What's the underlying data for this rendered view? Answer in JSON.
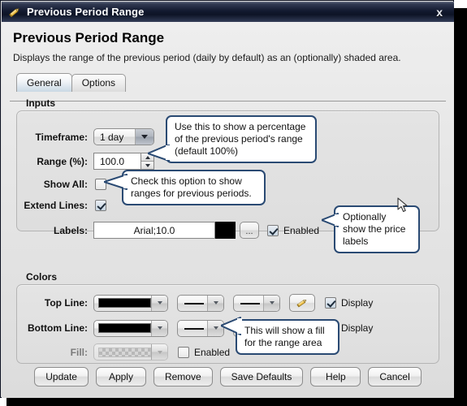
{
  "window": {
    "title": "Previous Period Range",
    "title_icon": "pencil-icon",
    "close_label": "x"
  },
  "header": {
    "title": "Previous Period Range",
    "description": "Displays the range of the previous period (daily by default) as an (optionally) shaded area."
  },
  "tabs": [
    {
      "label": "General",
      "active": true
    },
    {
      "label": "Options",
      "active": false
    }
  ],
  "inputs": {
    "group_label": "Inputs",
    "timeframe": {
      "label": "Timeframe:",
      "value": "1 day"
    },
    "range": {
      "label": "Range (%):",
      "value": "100.0"
    },
    "show_all": {
      "label": "Show All:",
      "checked": false
    },
    "extend_lines": {
      "label": "Extend Lines:",
      "checked": true
    },
    "labels": {
      "label": "Labels:",
      "value": "Arial;10.0",
      "color": "#000000",
      "browse_label": "...",
      "enabled_label": "Enabled",
      "enabled": true
    }
  },
  "colors": {
    "group_label": "Colors",
    "top_line": {
      "label": "Top Line:",
      "color": "#000000",
      "style": "solid-line",
      "weight": "solid-line",
      "edit_icon": "pencil-icon",
      "display_label": "Display",
      "display": true
    },
    "bottom_line": {
      "label": "Bottom Line:",
      "color": "#000000",
      "style": "solid-line",
      "weight": "solid-line",
      "edit_icon": "pencil-icon",
      "display_label": "Display",
      "display": true
    },
    "fill": {
      "label": "Fill:",
      "color": "transparent-checker",
      "enabled_label": "Enabled",
      "enabled": false,
      "disabled": true
    }
  },
  "buttons": [
    {
      "label": "Update"
    },
    {
      "label": "Apply"
    },
    {
      "label": "Remove"
    },
    {
      "label": "Save Defaults"
    },
    {
      "label": "Help"
    },
    {
      "label": "Cancel"
    }
  ],
  "callouts": [
    {
      "text": "Use this to show a percentage of the previous period's range (default 100%)"
    },
    {
      "text": "Check this option to show ranges for previous periods."
    },
    {
      "text": "Optionally show the price labels"
    },
    {
      "text": "This will show a fill for the range area"
    }
  ],
  "theme": {
    "titlebar_dark": "#0d1426",
    "callout_border": "#2a4a73",
    "accent_check": "#1d2b3a",
    "dialog_bg": "#e3e3e3"
  }
}
